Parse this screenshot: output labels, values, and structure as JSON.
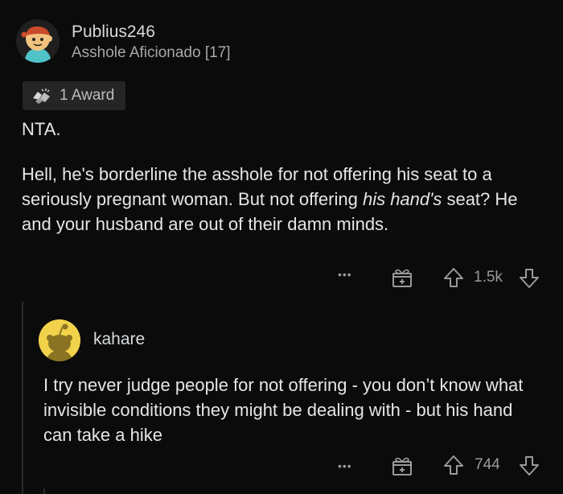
{
  "comment1": {
    "username": "Publius246",
    "flair": "Asshole Aficionado [17]",
    "award_label": "1 Award",
    "body_line1": "NTA.",
    "body_p2_part1": "Hell, he's borderline the asshole for not offering his seat to a seriously pregnant woman.  But not offering ",
    "body_p2_italic": "his hand's",
    "body_p2_part2": " seat?  He and your husband are out of their damn minds.",
    "vote_count": "1.5k",
    "more_label": "•••"
  },
  "comment2": {
    "username": "kahare",
    "body": "I try never judge people for not offering - you don’t know what invisible conditions they might be dealing with - but his hand can take a hike",
    "vote_count": "744",
    "more_label": "•••"
  },
  "colors": {
    "background": "#0b0b0b",
    "text": "#e6e6e6",
    "muted": "#a8a8a8",
    "avatar2_bg": "#f2d24a"
  },
  "icons": [
    "avatar-icon",
    "award-icon",
    "gift-icon",
    "upvote-icon",
    "downvote-icon",
    "more-icon"
  ]
}
